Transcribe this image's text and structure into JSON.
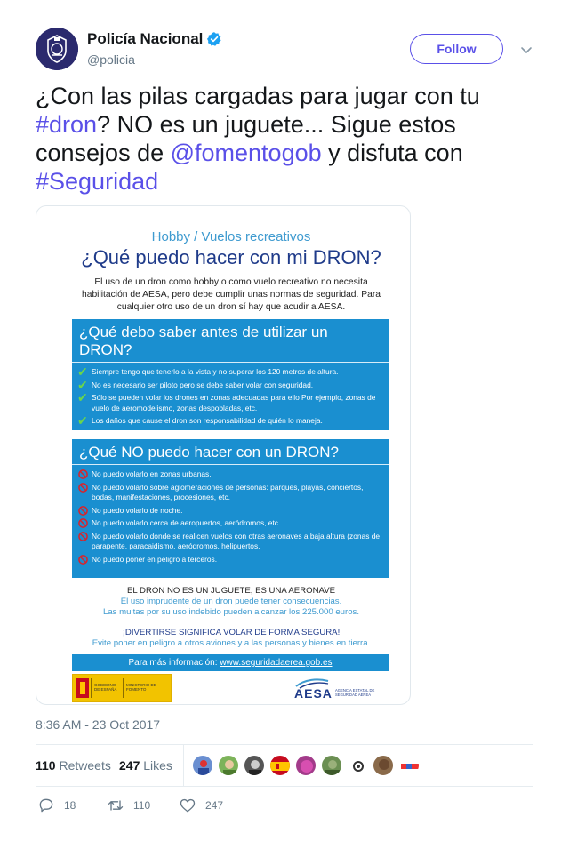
{
  "account": {
    "display_name": "Policía Nacional",
    "handle": "@policia",
    "verified": true,
    "follow_label": "Follow"
  },
  "tweet": {
    "text_parts": {
      "p1": "¿Con las pilas cargadas para jugar con tu ",
      "h1": "#dron",
      "p2": "? NO es un juguete... Sigue estos consejos de ",
      "m1": "@fomentogob",
      "p3": " y disfuta con ",
      "h2": "#Seguridad"
    },
    "timestamp": "8:36 AM - 23 Oct 2017"
  },
  "poster": {
    "hobby": "Hobby / Vuelos recreativos",
    "title": "¿Qué puedo hacer con mi DRON?",
    "intro": "El uso de un dron como hobby o como vuelo recreativo no necesita habilitación de AESA, pero debe cumplir unas normas de seguridad. Para cualquier otro uso de un dron sí hay que acudir a AESA.",
    "box1_title": "¿Qué debo saber antes de utilizar un DRON?",
    "box1_items": [
      "Siempre tengo que tenerlo a la vista y no superar los 120 metros de altura.",
      "No es necesario ser piloto pero se debe saber volar con seguridad.",
      "Sólo se pueden volar los drones en zonas adecuadas para ello Por ejemplo, zonas de vuelo de aeromodelismo, zonas despobladas, etc.",
      "Los daños que cause el dron son responsabilidad de quién lo maneja."
    ],
    "box2_title": "¿Qué NO puedo hacer con un DRON?",
    "box2_items": [
      "No puedo volarlo en zonas urbanas.",
      "No puedo volarlo sobre aglomeraciones de personas: parques, playas, conciertos, bodas, manifestaciones, procesiones, etc.",
      "No puedo volarlo de noche.",
      "No puedo volarlo cerca de aeropuertos, aeródromos, etc.",
      "No puedo volarlo donde se realicen vuelos con otras aeronaves a baja altura (zonas de parapente, paracaidismo, aeródromos, helipuertos,",
      "No puedo poner en peligro a terceros."
    ],
    "foot_title": "EL DRON NO ES UN JUGUETE, ES UNA AERONAVE",
    "foot_line1": "El uso imprudente de un dron puede tener consecuencias.",
    "foot_line2": "Las multas por su uso indebido pueden alcanzar los 225.000 euros.",
    "safe_title": "¡DIVERTIRSE SIGNIFICA VOLAR DE FORMA SEGURA!",
    "safe_line": "Evite poner en peligro a otros aviones y a las personas y bienes en tierra.",
    "info_label": "Para más información:",
    "info_url": "www.seguridadaerea.gob.es",
    "gov_label": "GOBIERNO DE ESPAÑA",
    "ministry_label": "MINISTERIO DE FOMENTO",
    "aesa_logo": "AESA",
    "aesa_full": "AGENCIA ESTATAL DE SEGURIDAD AÉREA"
  },
  "stats": {
    "retweets_count": "110",
    "retweets_label": "Retweets",
    "likes_count": "247",
    "likes_label": "Likes"
  },
  "actions": {
    "reply_count": "18",
    "retweet_count": "110",
    "like_count": "247"
  },
  "colors": {
    "link": "#5a50e8",
    "poster_blue": "#1a8fd0",
    "text_secondary": "#657786"
  }
}
